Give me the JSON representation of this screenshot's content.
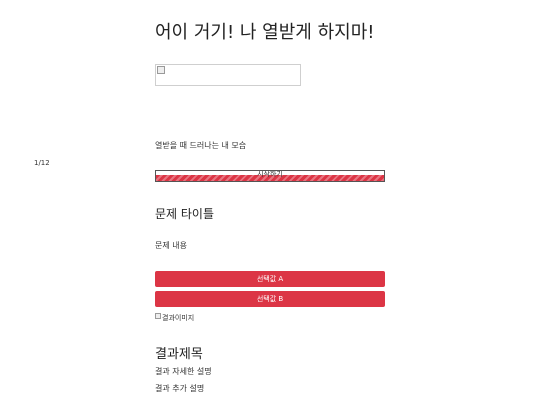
{
  "header": {
    "title": "어이 거기! 나 열받게 하지마!"
  },
  "hero": {
    "caption": "열받을 때 드러나는 내 모습"
  },
  "progress": {
    "counter": "1/12",
    "label": "시작하기",
    "value": 1,
    "max": 12,
    "fill_color": "#dc3545"
  },
  "question": {
    "title": "문제 타이틀",
    "body": "문제 내용",
    "choices": [
      {
        "label": "선택값 A"
      },
      {
        "label": "선택값 B"
      }
    ],
    "button_color": "#dc3545"
  },
  "result": {
    "image_alt": "결과이미지",
    "title": "결과제목",
    "description": "결과 자세한 설명",
    "extra": "결과 추가 설명"
  }
}
